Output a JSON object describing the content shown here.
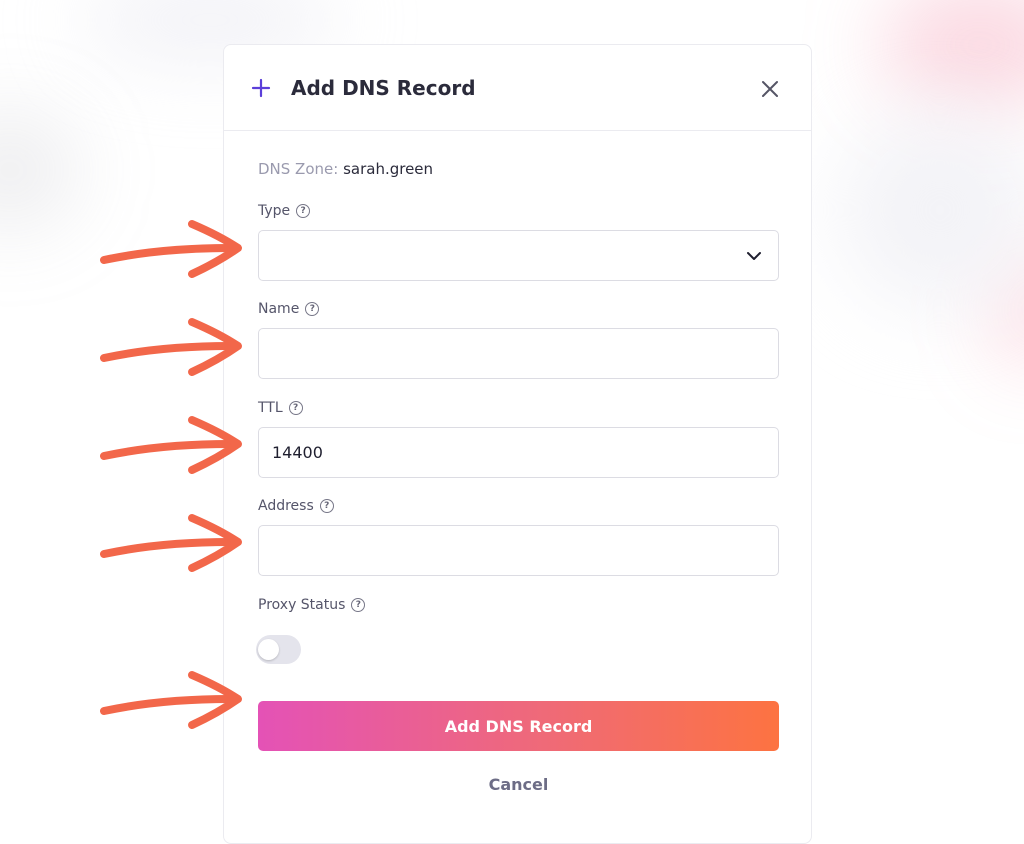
{
  "modal": {
    "title": "Add DNS Record",
    "zone_label": "DNS Zone: ",
    "zone_value": "sarah.green",
    "fields": {
      "type": {
        "label": "Type",
        "value": ""
      },
      "name": {
        "label": "Name",
        "value": ""
      },
      "ttl": {
        "label": "TTL",
        "value": "14400"
      },
      "address": {
        "label": "Address",
        "value": ""
      },
      "proxy_status": {
        "label": "Proxy Status",
        "enabled": false
      }
    },
    "help_glyph": "?",
    "submit_label": "Add DNS Record",
    "cancel_label": "Cancel"
  },
  "colors": {
    "accent_plus": "#5b3fd9",
    "arrow": "#f2674a",
    "button_gradient": [
      "#e452b6",
      "#fd7341"
    ]
  },
  "icons": [
    "plus-icon",
    "close-icon",
    "help-icon",
    "chevron-down-icon",
    "annotation-arrow-icon"
  ]
}
